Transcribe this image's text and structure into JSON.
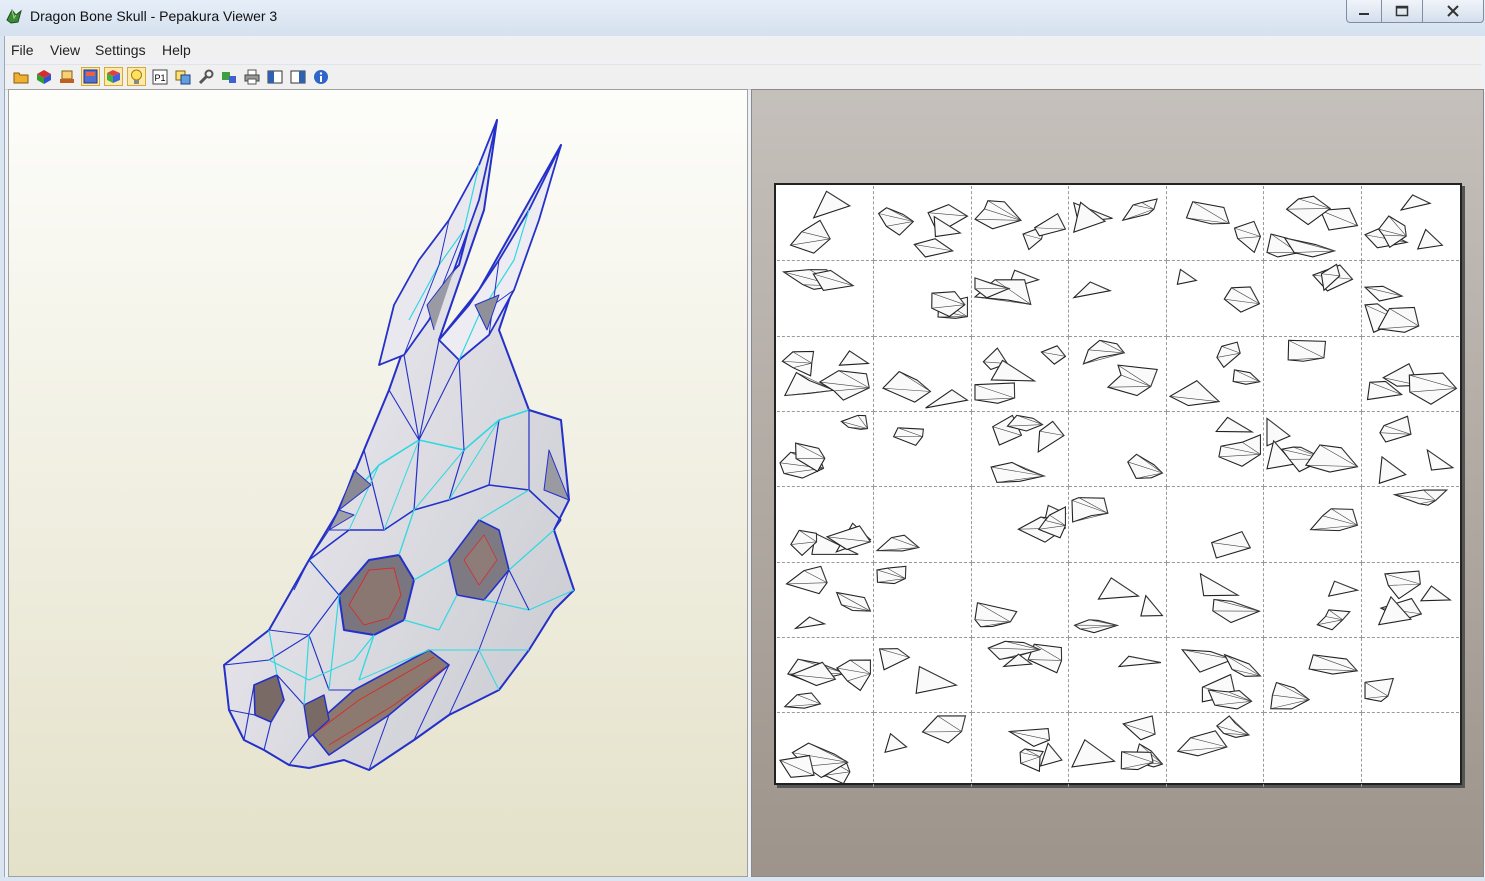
{
  "window": {
    "title": "Dragon Bone Skull - Pepakura Viewer 3"
  },
  "menu": [
    "File",
    "View",
    "Settings",
    "Help"
  ],
  "toolbar": [
    {
      "icon": "open-folder-icon",
      "active": false
    },
    {
      "icon": "3d-model-icon",
      "active": false
    },
    {
      "icon": "print-setup-icon",
      "active": false
    },
    {
      "icon": "texture-icon",
      "active": true
    },
    {
      "icon": "color-cube-icon",
      "active": true
    },
    {
      "icon": "lightbulb-icon",
      "active": true
    },
    {
      "icon": "page-number-icon",
      "active": false
    },
    {
      "icon": "layers-icon",
      "active": false
    },
    {
      "icon": "wrench-icon",
      "active": false
    },
    {
      "icon": "unfold-icon",
      "active": false
    },
    {
      "icon": "printer-icon",
      "active": false
    },
    {
      "icon": "panel-left-icon",
      "active": false
    },
    {
      "icon": "panel-right-icon",
      "active": false
    },
    {
      "icon": "info-icon",
      "active": false
    }
  ],
  "toolbar_labels": {
    "page_number": "P1"
  },
  "pattern_sheet": {
    "columns": 7,
    "rows": 8,
    "filled_cells": 54
  },
  "colors": {
    "wire_blue": "#2430c8",
    "wire_cyan": "#30d8e0",
    "accent_red": "#d03030"
  }
}
